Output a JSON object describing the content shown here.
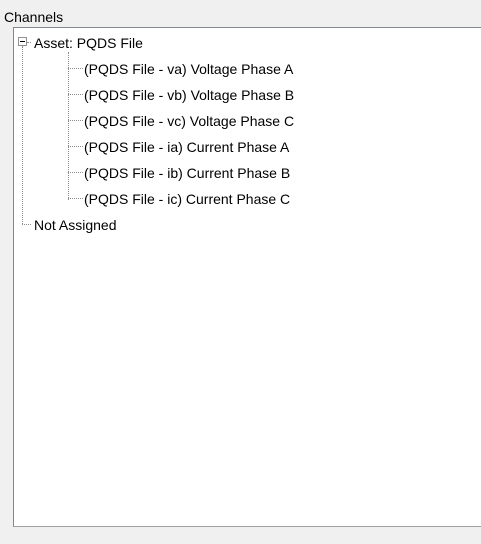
{
  "group": {
    "title": "Channels"
  },
  "tree": {
    "root": {
      "label": "Asset: PQDS File",
      "expanded": true,
      "children": [
        "(PQDS File - va) Voltage Phase A",
        "(PQDS File - vb) Voltage Phase B",
        "(PQDS File - vc) Voltage Phase C",
        "(PQDS File - ia) Current Phase A",
        "(PQDS File - ib) Current Phase B",
        "(PQDS File - ic) Current Phase C"
      ]
    },
    "unassigned": {
      "label": "Not Assigned"
    }
  }
}
